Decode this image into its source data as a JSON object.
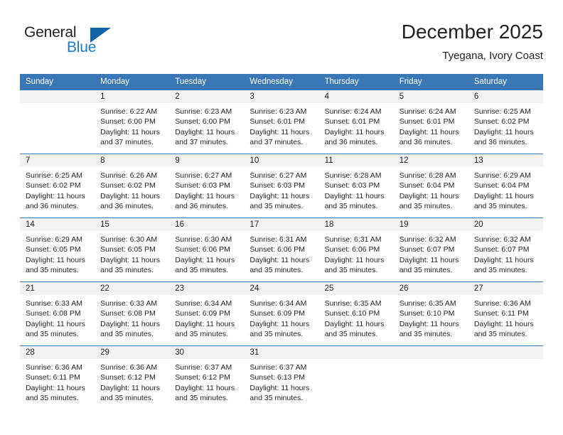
{
  "brand": {
    "name_part1": "General",
    "name_part2": "Blue",
    "triangle_color": "#1064a8",
    "blue_text_color": "#1b7bc4"
  },
  "header": {
    "title": "December 2025",
    "subtitle": "Tyegana, Ivory Coast",
    "header_bg_color": "#3a77b5",
    "header_text_color": "#ffffff",
    "daynum_band_color": "#f2f2f2"
  },
  "weekday_headers": [
    "Sunday",
    "Monday",
    "Tuesday",
    "Wednesday",
    "Thursday",
    "Friday",
    "Saturday"
  ],
  "labels": {
    "sunrise_prefix": "Sunrise: ",
    "sunset_prefix": "Sunset: ",
    "daylight_prefix": "Daylight: "
  },
  "weeks": [
    {
      "days": [
        {
          "num": "",
          "line1": "",
          "line2": "",
          "line3": "",
          "line4": ""
        },
        {
          "num": "1",
          "line1": "Sunrise: 6:22 AM",
          "line2": "Sunset: 6:00 PM",
          "line3": "Daylight: 11 hours",
          "line4": "and 37 minutes."
        },
        {
          "num": "2",
          "line1": "Sunrise: 6:23 AM",
          "line2": "Sunset: 6:00 PM",
          "line3": "Daylight: 11 hours",
          "line4": "and 37 minutes."
        },
        {
          "num": "3",
          "line1": "Sunrise: 6:23 AM",
          "line2": "Sunset: 6:01 PM",
          "line3": "Daylight: 11 hours",
          "line4": "and 37 minutes."
        },
        {
          "num": "4",
          "line1": "Sunrise: 6:24 AM",
          "line2": "Sunset: 6:01 PM",
          "line3": "Daylight: 11 hours",
          "line4": "and 36 minutes."
        },
        {
          "num": "5",
          "line1": "Sunrise: 6:24 AM",
          "line2": "Sunset: 6:01 PM",
          "line3": "Daylight: 11 hours",
          "line4": "and 36 minutes."
        },
        {
          "num": "6",
          "line1": "Sunrise: 6:25 AM",
          "line2": "Sunset: 6:02 PM",
          "line3": "Daylight: 11 hours",
          "line4": "and 36 minutes."
        }
      ]
    },
    {
      "days": [
        {
          "num": "7",
          "line1": "Sunrise: 6:25 AM",
          "line2": "Sunset: 6:02 PM",
          "line3": "Daylight: 11 hours",
          "line4": "and 36 minutes."
        },
        {
          "num": "8",
          "line1": "Sunrise: 6:26 AM",
          "line2": "Sunset: 6:02 PM",
          "line3": "Daylight: 11 hours",
          "line4": "and 36 minutes."
        },
        {
          "num": "9",
          "line1": "Sunrise: 6:27 AM",
          "line2": "Sunset: 6:03 PM",
          "line3": "Daylight: 11 hours",
          "line4": "and 36 minutes."
        },
        {
          "num": "10",
          "line1": "Sunrise: 6:27 AM",
          "line2": "Sunset: 6:03 PM",
          "line3": "Daylight: 11 hours",
          "line4": "and 35 minutes."
        },
        {
          "num": "11",
          "line1": "Sunrise: 6:28 AM",
          "line2": "Sunset: 6:03 PM",
          "line3": "Daylight: 11 hours",
          "line4": "and 35 minutes."
        },
        {
          "num": "12",
          "line1": "Sunrise: 6:28 AM",
          "line2": "Sunset: 6:04 PM",
          "line3": "Daylight: 11 hours",
          "line4": "and 35 minutes."
        },
        {
          "num": "13",
          "line1": "Sunrise: 6:29 AM",
          "line2": "Sunset: 6:04 PM",
          "line3": "Daylight: 11 hours",
          "line4": "and 35 minutes."
        }
      ]
    },
    {
      "days": [
        {
          "num": "14",
          "line1": "Sunrise: 6:29 AM",
          "line2": "Sunset: 6:05 PM",
          "line3": "Daylight: 11 hours",
          "line4": "and 35 minutes."
        },
        {
          "num": "15",
          "line1": "Sunrise: 6:30 AM",
          "line2": "Sunset: 6:05 PM",
          "line3": "Daylight: 11 hours",
          "line4": "and 35 minutes."
        },
        {
          "num": "16",
          "line1": "Sunrise: 6:30 AM",
          "line2": "Sunset: 6:06 PM",
          "line3": "Daylight: 11 hours",
          "line4": "and 35 minutes."
        },
        {
          "num": "17",
          "line1": "Sunrise: 6:31 AM",
          "line2": "Sunset: 6:06 PM",
          "line3": "Daylight: 11 hours",
          "line4": "and 35 minutes."
        },
        {
          "num": "18",
          "line1": "Sunrise: 6:31 AM",
          "line2": "Sunset: 6:06 PM",
          "line3": "Daylight: 11 hours",
          "line4": "and 35 minutes."
        },
        {
          "num": "19",
          "line1": "Sunrise: 6:32 AM",
          "line2": "Sunset: 6:07 PM",
          "line3": "Daylight: 11 hours",
          "line4": "and 35 minutes."
        },
        {
          "num": "20",
          "line1": "Sunrise: 6:32 AM",
          "line2": "Sunset: 6:07 PM",
          "line3": "Daylight: 11 hours",
          "line4": "and 35 minutes."
        }
      ]
    },
    {
      "days": [
        {
          "num": "21",
          "line1": "Sunrise: 6:33 AM",
          "line2": "Sunset: 6:08 PM",
          "line3": "Daylight: 11 hours",
          "line4": "and 35 minutes."
        },
        {
          "num": "22",
          "line1": "Sunrise: 6:33 AM",
          "line2": "Sunset: 6:08 PM",
          "line3": "Daylight: 11 hours",
          "line4": "and 35 minutes."
        },
        {
          "num": "23",
          "line1": "Sunrise: 6:34 AM",
          "line2": "Sunset: 6:09 PM",
          "line3": "Daylight: 11 hours",
          "line4": "and 35 minutes."
        },
        {
          "num": "24",
          "line1": "Sunrise: 6:34 AM",
          "line2": "Sunset: 6:09 PM",
          "line3": "Daylight: 11 hours",
          "line4": "and 35 minutes."
        },
        {
          "num": "25",
          "line1": "Sunrise: 6:35 AM",
          "line2": "Sunset: 6:10 PM",
          "line3": "Daylight: 11 hours",
          "line4": "and 35 minutes."
        },
        {
          "num": "26",
          "line1": "Sunrise: 6:35 AM",
          "line2": "Sunset: 6:10 PM",
          "line3": "Daylight: 11 hours",
          "line4": "and 35 minutes."
        },
        {
          "num": "27",
          "line1": "Sunrise: 6:36 AM",
          "line2": "Sunset: 6:11 PM",
          "line3": "Daylight: 11 hours",
          "line4": "and 35 minutes."
        }
      ]
    },
    {
      "days": [
        {
          "num": "28",
          "line1": "Sunrise: 6:36 AM",
          "line2": "Sunset: 6:11 PM",
          "line3": "Daylight: 11 hours",
          "line4": "and 35 minutes."
        },
        {
          "num": "29",
          "line1": "Sunrise: 6:36 AM",
          "line2": "Sunset: 6:12 PM",
          "line3": "Daylight: 11 hours",
          "line4": "and 35 minutes."
        },
        {
          "num": "30",
          "line1": "Sunrise: 6:37 AM",
          "line2": "Sunset: 6:12 PM",
          "line3": "Daylight: 11 hours",
          "line4": "and 35 minutes."
        },
        {
          "num": "31",
          "line1": "Sunrise: 6:37 AM",
          "line2": "Sunset: 6:13 PM",
          "line3": "Daylight: 11 hours",
          "line4": "and 35 minutes."
        },
        {
          "num": "",
          "line1": "",
          "line2": "",
          "line3": "",
          "line4": ""
        },
        {
          "num": "",
          "line1": "",
          "line2": "",
          "line3": "",
          "line4": ""
        },
        {
          "num": "",
          "line1": "",
          "line2": "",
          "line3": "",
          "line4": ""
        }
      ]
    }
  ]
}
